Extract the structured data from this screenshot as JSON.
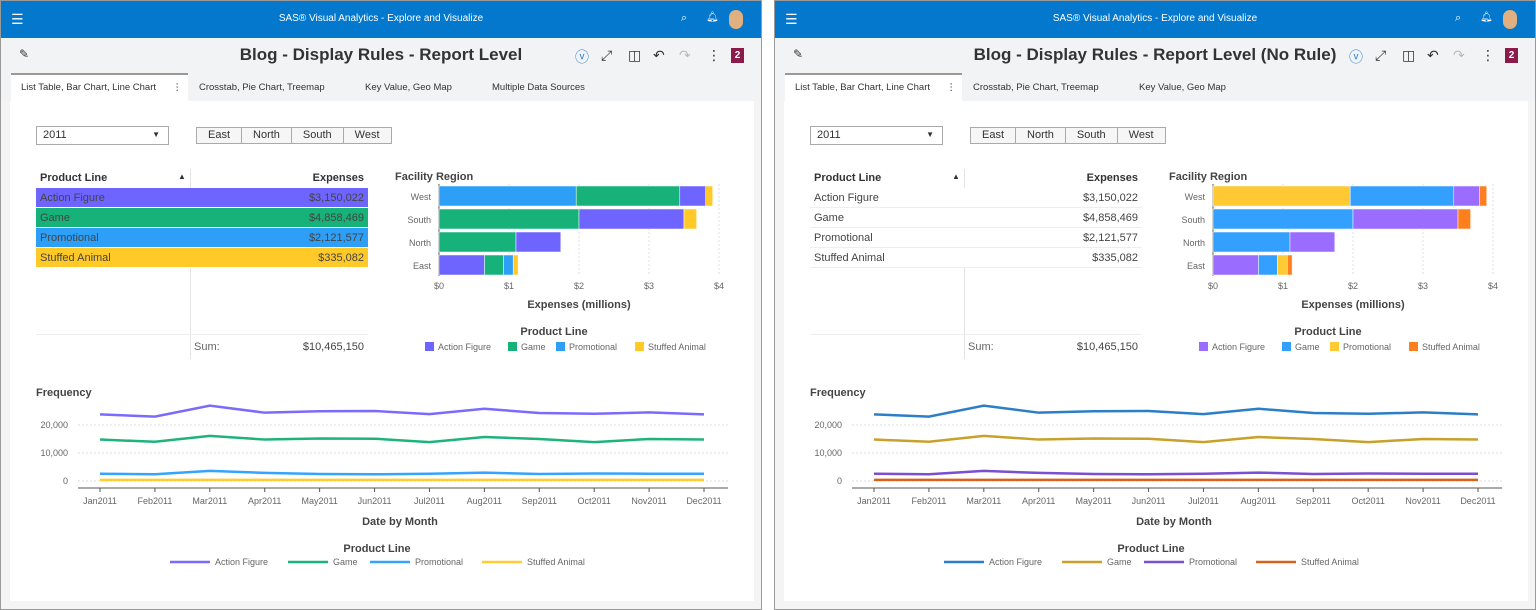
{
  "panels": [
    {
      "app_title": "SAS® Visual Analytics - Explore and Visualize",
      "report_title": "Blog - Display Rules - Report Level",
      "badge": "2",
      "tabs": [
        "List Table, Bar Chart, Line Chart",
        "Crosstab, Pie Chart, Treemap",
        "Key Value, Geo Map",
        "Multiple Data Sources"
      ],
      "year_select": "2011",
      "region_buttons": [
        "East",
        "North",
        "South",
        "West"
      ],
      "table": {
        "headers": [
          "Product Line",
          "Expenses"
        ],
        "rows": [
          [
            "Action Figure",
            "$3,150,022"
          ],
          [
            "Game",
            "$4,858,469"
          ],
          [
            "Promotional",
            "$2,121,577"
          ],
          [
            "Stuffed Animal",
            "$335,082"
          ]
        ],
        "row_colors": [
          "#6e64ff",
          "#16b27a",
          "#2e9ff7",
          "#ffc928"
        ],
        "sum_label": "Sum:",
        "sum_value": "$10,465,150"
      },
      "colors": {
        "Action Figure": "#6e64ff",
        "Game": "#16b27a",
        "Promotional": "#2e9ff7",
        "Stuffed Animal": "#ffc928"
      },
      "line_colors": {
        "Action Figure": "#7a6bff",
        "Game": "#1fb37c",
        "Promotional": "#36a3ff",
        "Stuffed Animal": "#ffcc33"
      }
    },
    {
      "app_title": "SAS® Visual Analytics - Explore and Visualize",
      "report_title": "Blog - Display Rules - Report Level (No Rule)",
      "badge": "2",
      "tabs": [
        "List Table, Bar Chart, Line Chart",
        "Crosstab, Pie Chart, Treemap",
        "Key Value, Geo Map"
      ],
      "year_select": "2011",
      "region_buttons": [
        "East",
        "North",
        "South",
        "West"
      ],
      "table": {
        "headers": [
          "Product Line",
          "Expenses"
        ],
        "rows": [
          [
            "Action Figure",
            "$3,150,022"
          ],
          [
            "Game",
            "$4,858,469"
          ],
          [
            "Promotional",
            "$2,121,577"
          ],
          [
            "Stuffed Animal",
            "$335,082"
          ]
        ],
        "row_colors": [],
        "sum_label": "Sum:",
        "sum_value": "$10,465,150"
      },
      "colors": {
        "Action Figure": "#9a6cff",
        "Game": "#33a0ff",
        "Promotional": "#ffc933",
        "Stuffed Animal": "#ff7f1e"
      },
      "line_colors": {
        "Action Figure": "#2c7ec6",
        "Game": "#c9a02a",
        "Promotional": "#7a4fd0",
        "Stuffed Animal": "#d8621c"
      }
    }
  ],
  "chart_data": [
    {
      "type": "bar",
      "orientation": "horizontal",
      "stacked": true,
      "title": "Facility Region",
      "xlabel": "Expenses (millions)",
      "legend_title": "Product Line",
      "legend": "bottom",
      "categories": [
        "West",
        "South",
        "North",
        "East"
      ],
      "xlim": [
        0,
        4
      ],
      "xticks": [
        "$0",
        "$1",
        "$2",
        "$3",
        "$4"
      ],
      "segment_order": [
        [
          "Promotional",
          "Game",
          "Action Figure",
          "Stuffed Animal"
        ],
        [
          "Game",
          "Action Figure",
          "Stuffed Animal"
        ],
        [
          "Game",
          "Action Figure"
        ],
        [
          "Action Figure",
          "Game",
          "Promotional",
          "Stuffed Animal"
        ]
      ],
      "series": [
        {
          "name": "Action Figure",
          "values": [
            0.37,
            1.5,
            0.64,
            0.65
          ]
        },
        {
          "name": "Game",
          "values": [
            1.48,
            2.0,
            1.1,
            0.27
          ]
        },
        {
          "name": "Promotional",
          "values": [
            1.96,
            0,
            0,
            0.14
          ]
        },
        {
          "name": "Stuffed Animal",
          "values": [
            0.1,
            0.18,
            0,
            0.07
          ]
        }
      ]
    },
    {
      "type": "line",
      "title": "Frequency",
      "xlabel": "Date by Month",
      "legend_title": "Product Line",
      "legend": "bottom",
      "ylim": [
        0,
        27000
      ],
      "yticks": [
        "0",
        "10,000",
        "20,000"
      ],
      "grid": true,
      "categories": [
        "Jan2011",
        "Feb2011",
        "Mar2011",
        "Apr2011",
        "May2011",
        "Jun2011",
        "Jul2011",
        "Aug2011",
        "Sep2011",
        "Oct2011",
        "Nov2011",
        "Dec2011"
      ],
      "series": [
        {
          "name": "Action Figure",
          "values": [
            23800,
            23000,
            26900,
            24400,
            24900,
            25000,
            23900,
            25800,
            24300,
            24000,
            24500,
            23800
          ]
        },
        {
          "name": "Game",
          "values": [
            14800,
            14000,
            16100,
            14800,
            15200,
            15100,
            13900,
            15700,
            15000,
            13900,
            15000,
            14800
          ]
        },
        {
          "name": "Promotional",
          "values": [
            2600,
            2400,
            3600,
            2900,
            2500,
            2400,
            2600,
            3000,
            2500,
            2700,
            2600,
            2600
          ]
        },
        {
          "name": "Stuffed Animal",
          "values": [
            400,
            400,
            400,
            400,
            400,
            400,
            400,
            400,
            400,
            400,
            400,
            400
          ]
        }
      ]
    }
  ]
}
